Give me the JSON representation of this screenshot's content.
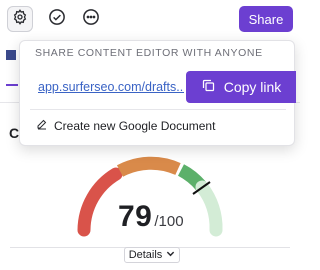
{
  "toolbar": {
    "settings_icon": "gear-icon",
    "check_icon": "check-circle-icon",
    "more_icon": "more-horizontal-icon",
    "share_label": "Share",
    "share_color": "#6c3fd1"
  },
  "background": {
    "section_heading": "C"
  },
  "share_popup": {
    "title": "SHARE CONTENT EDITOR WITH ANYONE",
    "link": "app.surferseo.com/drafts...",
    "copy_label": "Copy link",
    "copy_icon": "copy-icon",
    "new_doc_label": "Create new Google Document",
    "new_doc_icon": "pencil-icon"
  },
  "score": {
    "value": "79",
    "max": "/100",
    "fraction": 0.79,
    "colors": {
      "red": "#d9534a",
      "orange": "#d98a4a",
      "green": "#5cb06a",
      "light_green": "#d3ecd6"
    }
  },
  "details": {
    "label": "Details",
    "icon": "chevron-down-icon"
  }
}
